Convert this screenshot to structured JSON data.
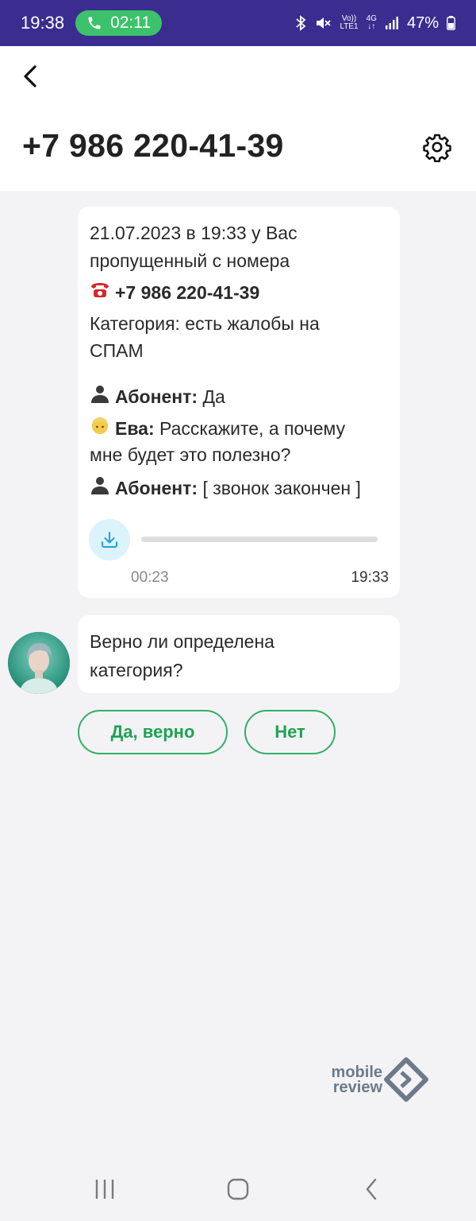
{
  "status_bar": {
    "time": "19:38",
    "call_duration": "02:11",
    "network_top": "Vo))",
    "network_bottom": "LTE1",
    "net_type": "4G",
    "battery": "47%"
  },
  "header": {
    "title": "+7 986 220-41-39"
  },
  "message": {
    "line1": "21.07.2023 в 19:33 у Вас",
    "line2": "пропущенный с номера",
    "phone": "+7 986 220-41-39",
    "category_line1": "Категория: есть жалобы на",
    "category_line2": "СПАМ",
    "dialog": [
      {
        "speaker": "Абонент:",
        "text": " Да"
      },
      {
        "speaker": "Ева:",
        "text": " Расскажите, а почему"
      },
      {
        "speaker": "",
        "text": "мне будет это полезно?"
      },
      {
        "speaker": "Абонент:",
        "text": " [ звонок закончен ]"
      }
    ],
    "audio_duration": "00:23",
    "audio_progress": 0,
    "time": "19:33"
  },
  "question": {
    "line1": "Верно ли определена",
    "line2": "категория?"
  },
  "answers": {
    "yes": "Да, верно",
    "no": "Нет"
  },
  "watermark": {
    "line1": "mobile",
    "line2": "review"
  },
  "colors": {
    "status_bar": "#3b2d8f",
    "call_pill": "#3cc26a",
    "accent_green": "#1ea352",
    "download_bg": "#dbf3fb"
  }
}
